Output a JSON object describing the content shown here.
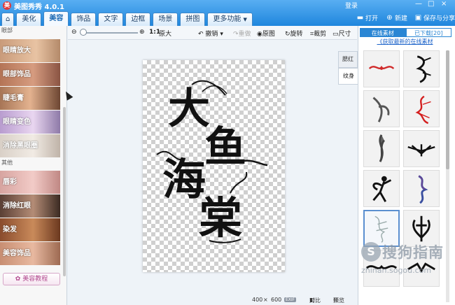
{
  "app": {
    "logo": "美",
    "title": "美图秀秀 4.0.1",
    "login": "登录"
  },
  "window_controls": [
    "—",
    "□",
    "×"
  ],
  "tabs": [
    {
      "label": "⌂",
      "icon": "home-icon"
    },
    {
      "label": "美化"
    },
    {
      "label": "美容",
      "active": true
    },
    {
      "label": "饰品"
    },
    {
      "label": "文字"
    },
    {
      "label": "边框"
    },
    {
      "label": "场景"
    },
    {
      "label": "拼图"
    },
    {
      "label": "更多功能",
      "dropdown": true
    }
  ],
  "right_actions": {
    "open": "打开",
    "new": "新建",
    "save": "保存与分享"
  },
  "left_panel": {
    "section1": "眼部",
    "eye_items": [
      "眼睛放大",
      "眼部饰品",
      "睫毛膏",
      "眼睛变色",
      "消除黑眼圈"
    ],
    "section2": "其他",
    "other_items": [
      "唇彩",
      "消除红眼",
      "染发",
      "美容饰品"
    ],
    "tutorial": "美容教程"
  },
  "toolbar": {
    "zoom_ratio": "1:1",
    "original_size": "原大",
    "undo": "撤销",
    "redo": "重做",
    "original_image": "原图",
    "rotate": "旋转",
    "crop": "裁剪",
    "resize": "尺寸"
  },
  "canvas": {
    "text": [
      "大",
      "鱼",
      "海",
      "棠"
    ]
  },
  "status": {
    "width": "400",
    "times": "×",
    "height": "600",
    "exif": "EXIF",
    "compare": "对比",
    "preview": "预览"
  },
  "side_tabs": [
    "腮红",
    "纹身"
  ],
  "right_panel": {
    "tabs": [
      "在线素材",
      "已下载[20]"
    ],
    "link": "《获取最新的在线素材",
    "thumbnails": [
      "tribal-red-wing",
      "black-dragon",
      "grey-phoenix",
      "red-phoenix",
      "grey-flame",
      "black-tribal-crest",
      "fairy-silhouette",
      "blue-dragon",
      "grey-sketch-figure",
      "black-tribal-mask",
      "tribal-band-1",
      "tribal-band-2"
    ],
    "selected_thumbnail_index": 8
  },
  "watermark": {
    "circle": "S",
    "text": "搜狗指南",
    "url": "zhinan.sogou.com"
  },
  "colors": {
    "accent": "#2a86d4",
    "title_bar": "#1f86dd",
    "link": "#1b62c9",
    "tutorial": "#b24a8f"
  }
}
